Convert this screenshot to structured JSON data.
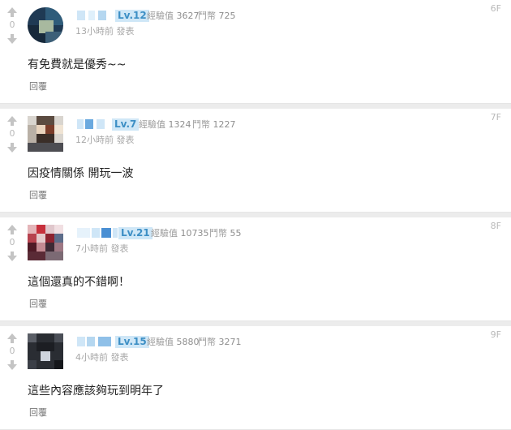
{
  "colors": {
    "level_bg": "#cfe7f7",
    "level_text": "#3d8fc5",
    "meta_text": "#9a9a9a",
    "divider": "#ececec"
  },
  "comments": [
    {
      "floor": "6F",
      "votes": "0",
      "level": "Lv.12",
      "exp_label": "經驗值",
      "exp_value": "3627",
      "coin_label": "鬥幣",
      "coin_value": "725",
      "time": "13小時前 發表",
      "content": "有免費就是優秀~~",
      "reply_label": "回覆"
    },
    {
      "floor": "7F",
      "votes": "0",
      "level": "Lv.7",
      "exp_label": "經驗值",
      "exp_value": "1324",
      "coin_label": "鬥幣",
      "coin_value": "1227",
      "time": "12小時前 發表",
      "content": "因疫情關係 開玩一波",
      "reply_label": "回覆"
    },
    {
      "floor": "8F",
      "votes": "0",
      "level": "Lv.21",
      "exp_label": "經驗值",
      "exp_value": "10735",
      "coin_label": "鬥幣",
      "coin_value": "55",
      "time": "7小時前 發表",
      "content": "這個還真的不錯啊！",
      "reply_label": "回覆"
    },
    {
      "floor": "9F",
      "votes": "0",
      "level": "Lv.15",
      "exp_label": "經驗值",
      "exp_value": "5880",
      "coin_label": "鬥幣",
      "coin_value": "3271",
      "time": "4小時前 發表",
      "content": "這些內容應該夠玩到明年了",
      "reply_label": "回覆"
    }
  ]
}
